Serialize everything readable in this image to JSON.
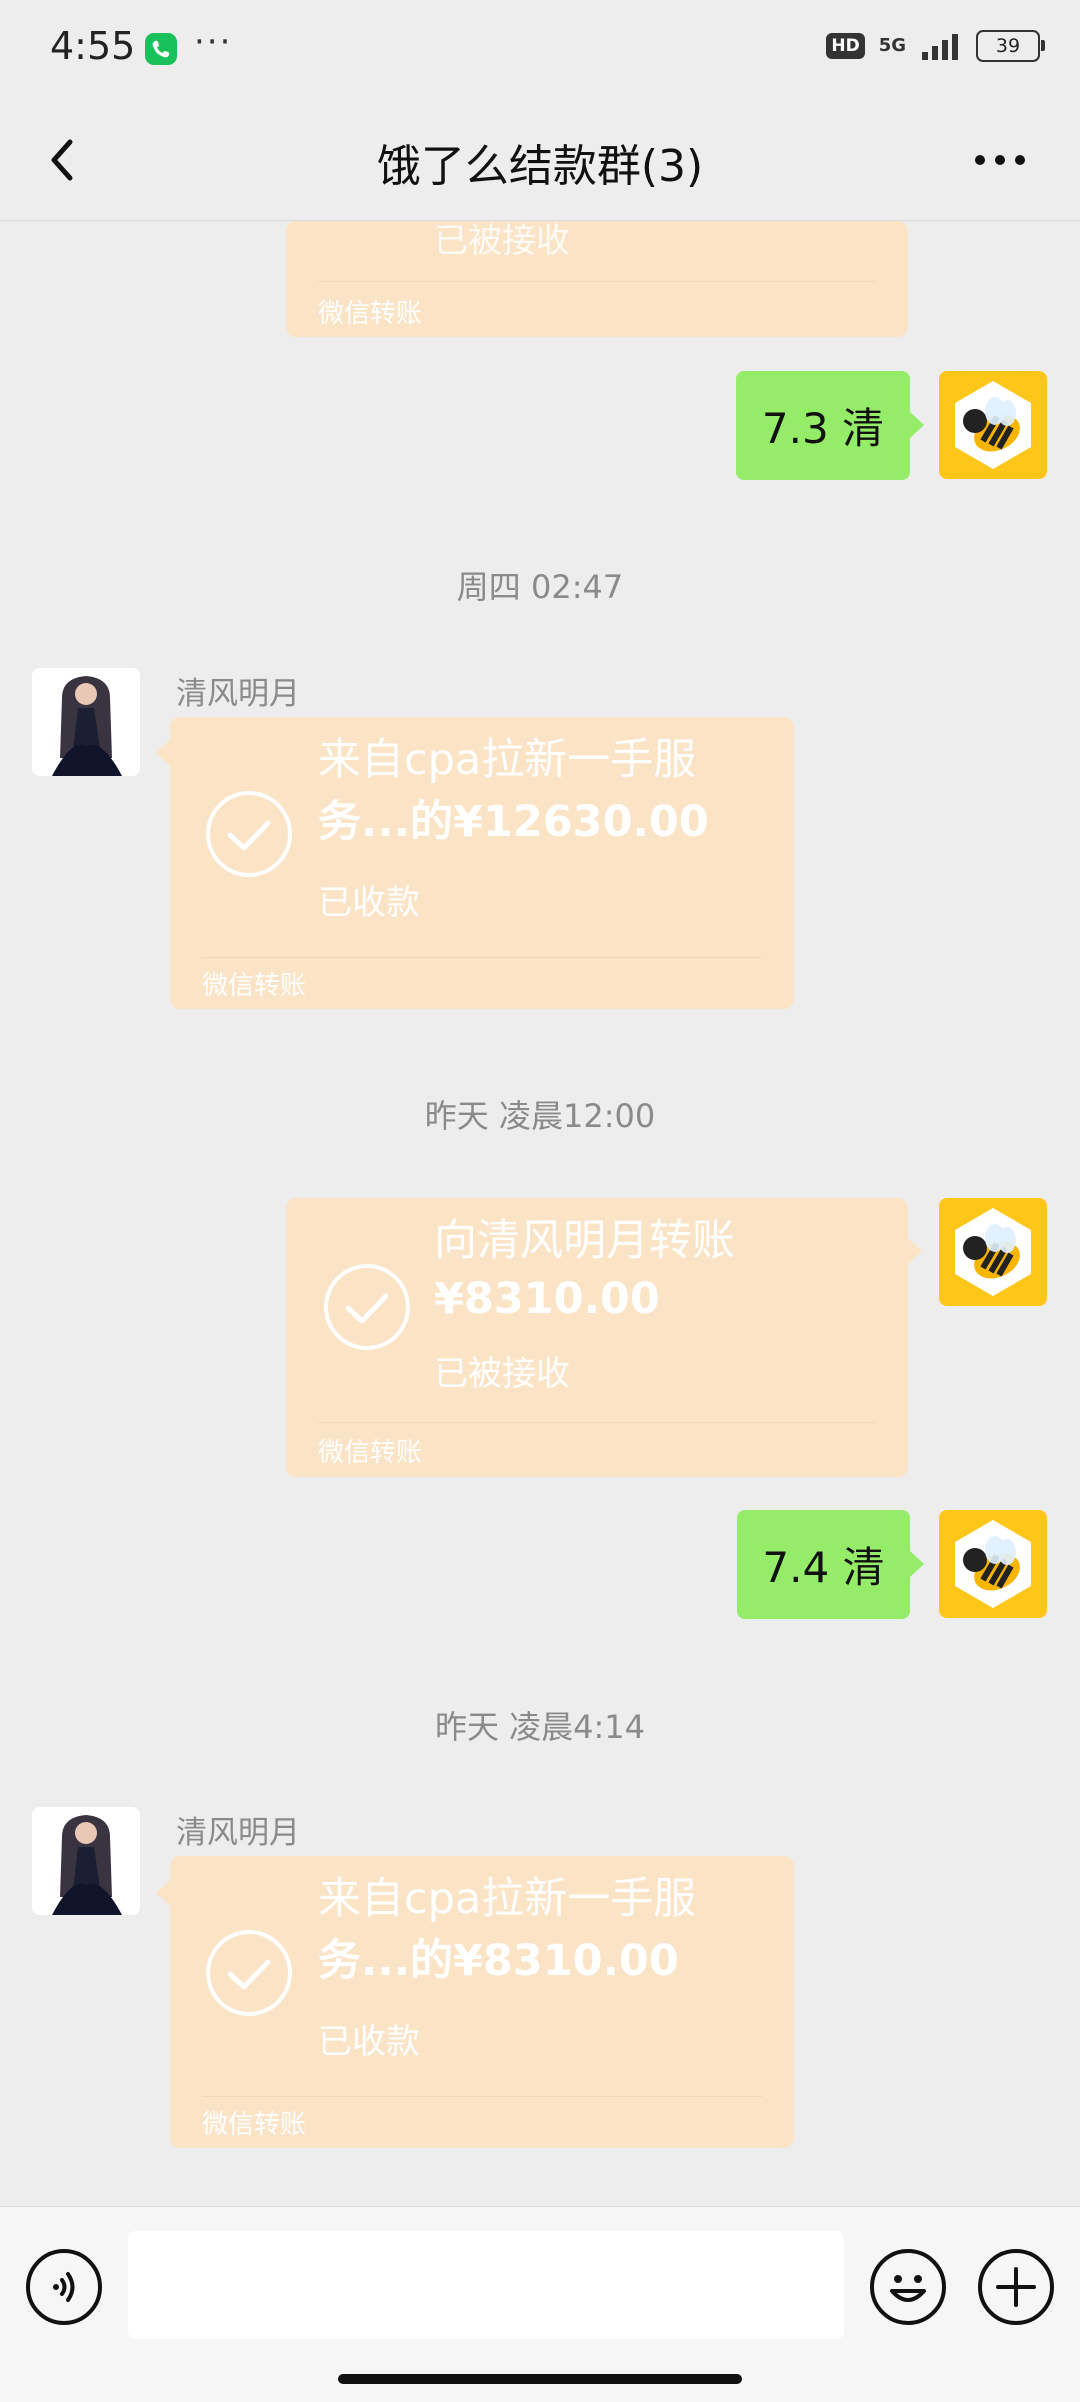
{
  "status_bar": {
    "time": "4:55",
    "dots": "···",
    "hd": "HD",
    "network": "5G",
    "battery": "39"
  },
  "header": {
    "title": "饿了么结款群(3)"
  },
  "messages": {
    "partial_transfer": {
      "status": "已被接收",
      "footer": "微信转账"
    },
    "msg1": {
      "text": "7.3 清"
    },
    "ts1": "周四 02:47",
    "transfer1": {
      "sender": "清风明月",
      "line1": "来自cpa拉新一手服",
      "line2": "务...的¥12630.00",
      "status": "已收款",
      "footer": "微信转账"
    },
    "ts2": "昨天 凌晨12:00",
    "transfer2": {
      "line1": "向清风明月转账",
      "line2": "¥8310.00",
      "status": "已被接收",
      "footer": "微信转账"
    },
    "msg2": {
      "text": "7.4 清"
    },
    "ts3": "昨天 凌晨4:14",
    "transfer3": {
      "sender": "清风明月",
      "line1": "来自cpa拉新一手服",
      "line2": "务...的¥8310.00",
      "status": "已收款",
      "footer": "微信转账"
    }
  },
  "colors": {
    "background": "#ededed",
    "green_bubble": "#95ec69",
    "transfer_bubble": "#fbe3c6",
    "bee_avatar": "#ffc61a"
  },
  "icons": [
    "back-arrow-icon",
    "more-icon",
    "voice-icon",
    "emoji-icon",
    "plus-icon",
    "check-icon",
    "bee-avatar",
    "person-avatar"
  ]
}
